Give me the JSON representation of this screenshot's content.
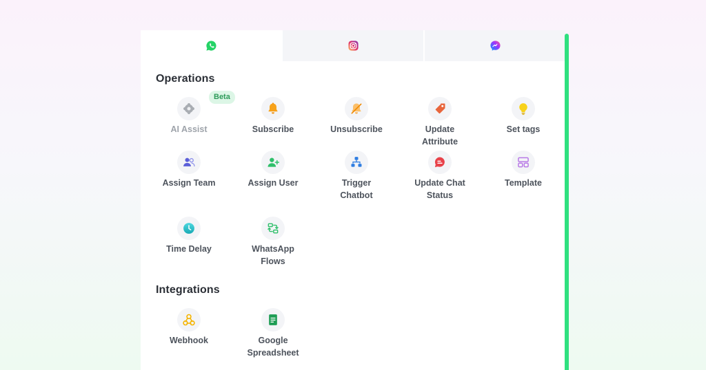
{
  "tabs": [
    {
      "icon": "whatsapp-icon",
      "active": true
    },
    {
      "icon": "instagram-icon",
      "active": false
    },
    {
      "icon": "messenger-icon",
      "active": false
    }
  ],
  "operations": {
    "title": "Operations",
    "items": [
      {
        "label": "AI Assist",
        "icon": "sparkle-icon",
        "badge": "Beta",
        "disabled": true
      },
      {
        "label": "Subscribe",
        "icon": "bell-icon"
      },
      {
        "label": "Unsubscribe",
        "icon": "bell-off-icon"
      },
      {
        "label": "Update\nAttribute",
        "icon": "tag-icon"
      },
      {
        "label": "Set tags",
        "icon": "lightbulb-icon"
      },
      {
        "label": "Assign Team",
        "icon": "team-icon"
      },
      {
        "label": "Assign User",
        "icon": "user-add-icon"
      },
      {
        "label": "Trigger\nChatbot",
        "icon": "flow-icon"
      },
      {
        "label": "Update Chat\nStatus",
        "icon": "chat-status-icon"
      },
      {
        "label": "Template",
        "icon": "template-icon"
      },
      {
        "label": "Time Delay",
        "icon": "clock-icon"
      },
      {
        "label": "WhatsApp\nFlows",
        "icon": "flows-icon"
      }
    ]
  },
  "integrations": {
    "title": "Integrations",
    "items": [
      {
        "label": "Webhook",
        "icon": "webhook-icon"
      },
      {
        "label": "Google\nSpreadsheet",
        "icon": "spreadsheet-icon"
      }
    ]
  },
  "colors": {
    "accent_bar": "#2fe07f",
    "whatsapp": "#25d366",
    "section_title": "#2b2f36",
    "label": "#4d535c",
    "badge_bg": "#dcf6e6",
    "badge_text": "#2e9b5a"
  }
}
